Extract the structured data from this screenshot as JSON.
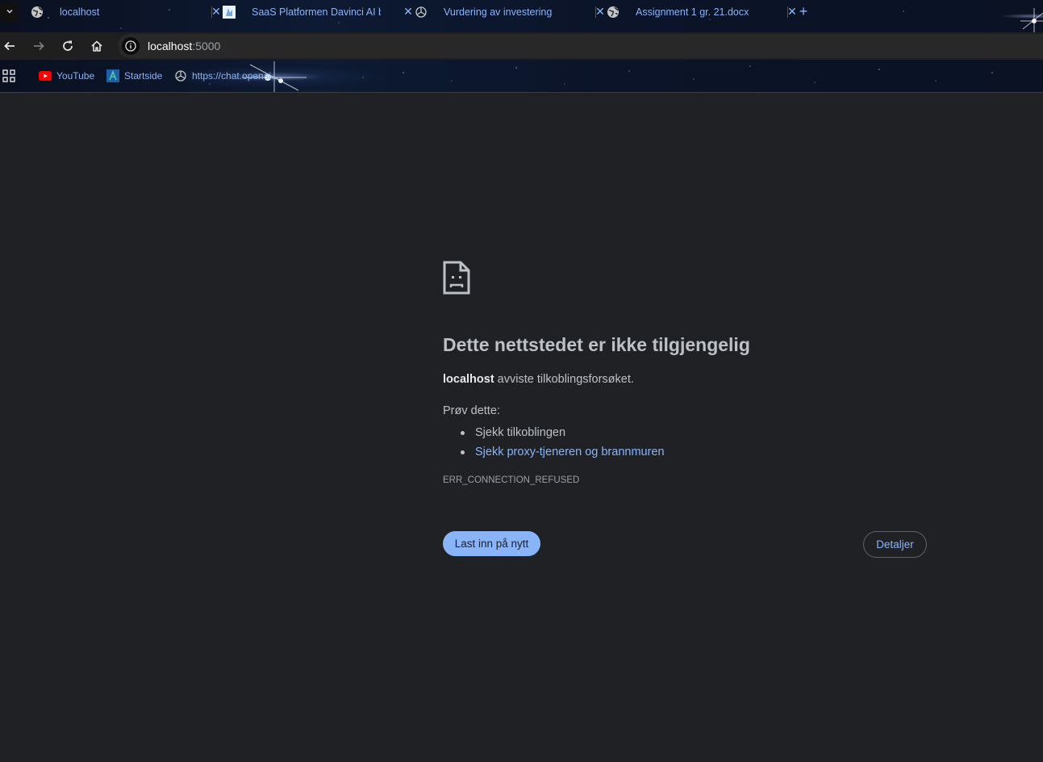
{
  "browser": {
    "tabs": [
      {
        "title": "localhost",
        "favicon": "globe-icon",
        "close": "✕"
      },
      {
        "title": "SaaS Platformen Davinci AI by",
        "favicon": "davinci-icon",
        "close": "✕"
      },
      {
        "title": "Vurdering av investering",
        "favicon": "openai-icon",
        "close": "✕"
      },
      {
        "title": "Assignment 1 gr. 21.docx",
        "favicon": "globe-icon",
        "close": "✕"
      }
    ],
    "new_tab": "+",
    "address": {
      "host": "localhost",
      "port": ":5000"
    },
    "bookmarks": [
      {
        "label": "YouTube",
        "icon": "youtube-icon"
      },
      {
        "label": "Startside",
        "icon": "startside-icon"
      },
      {
        "label": "https://chat.openai....",
        "icon": "openai-icon"
      }
    ]
  },
  "error_page": {
    "title": "Dette nettstedet er ikke tilgjengelig",
    "host": "localhost",
    "description": " avviste tilkoblingsforsøket.",
    "try_heading": "Prøv dette:",
    "suggestions": [
      "Sjekk tilkoblingen",
      "Sjekk proxy-tjeneren og brannmuren"
    ],
    "error_code": "ERR_CONNECTION_REFUSED",
    "reload_label": "Last inn på nytt",
    "details_label": "Detaljer"
  },
  "colors": {
    "background": "#202124",
    "accent": "#8ab4f8",
    "text": "#bdc1c6"
  }
}
